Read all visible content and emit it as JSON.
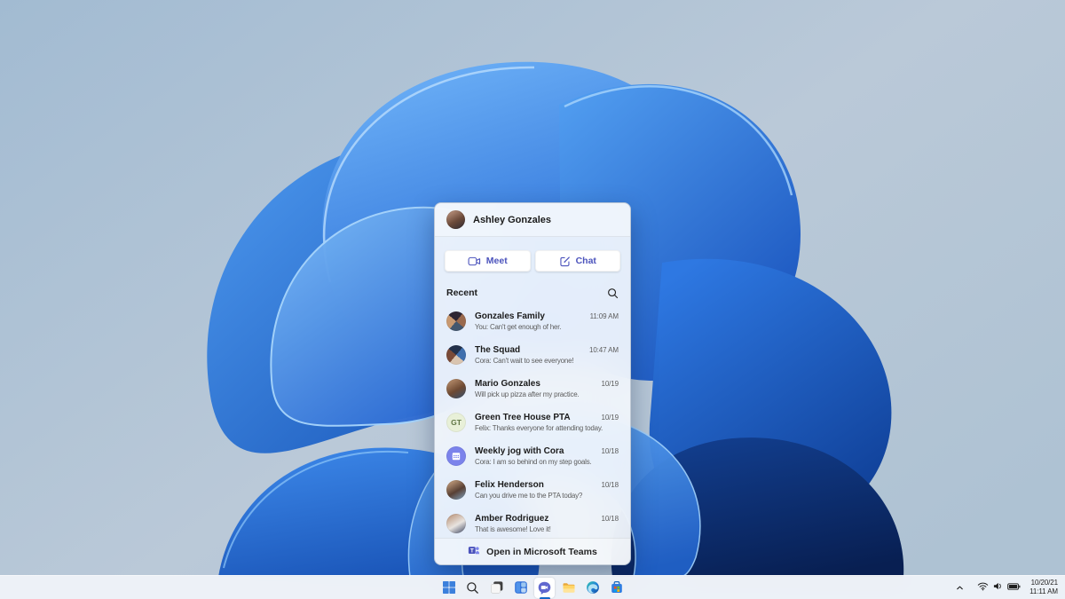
{
  "teams_panel": {
    "user": {
      "name": "Ashley Gonzales"
    },
    "actions": {
      "meet_label": "Meet",
      "chat_label": "Chat"
    },
    "recent_label": "Recent",
    "chats": [
      {
        "name": "Gonzales Family",
        "preview": "You: Can't get enough of her.",
        "time": "11:09 AM",
        "avatar": {
          "kind": "collage",
          "colors": [
            "#9a6a4e",
            "#43576e",
            "#c99a72",
            "#2e2633"
          ]
        }
      },
      {
        "name": "The Squad",
        "preview": "Cora: Can't wait to see everyone!",
        "time": "10:47 AM",
        "avatar": {
          "kind": "collage",
          "colors": [
            "#3f6fae",
            "#d9c4b0",
            "#7a4a38",
            "#23304a"
          ]
        }
      },
      {
        "name": "Mario Gonzales",
        "preview": "Will pick up pizza after my practice.",
        "time": "10/19",
        "avatar": {
          "kind": "photo",
          "colors": [
            "#c59a77",
            "#6e4a33",
            "#35506e"
          ]
        }
      },
      {
        "name": "Green Tree House PTA",
        "preview": "Felix: Thanks everyone for attending today.",
        "time": "10/19",
        "avatar": {
          "kind": "initials",
          "initials": "GT",
          "bg": "#e8f0d8",
          "fg": "#5f7544"
        }
      },
      {
        "name": "Weekly jog with Cora",
        "preview": "Cora: I am so behind on my step goals.",
        "time": "10/18",
        "avatar": {
          "kind": "glyph",
          "glyph": "calendar-icon",
          "bg": "#7b83eb"
        }
      },
      {
        "name": "Felix Henderson",
        "preview": "Can you drive me to the PTA today?",
        "time": "10/18",
        "avatar": {
          "kind": "photo",
          "colors": [
            "#d8b08c",
            "#584034",
            "#7fa3c0"
          ]
        }
      },
      {
        "name": "Amber Rodriguez",
        "preview": "That is awesome! Love it!",
        "time": "10/18",
        "avatar": {
          "kind": "photo",
          "colors": [
            "#b58a6d",
            "#e8e4e0",
            "#3c4560"
          ]
        }
      }
    ],
    "footer_label": "Open in Microsoft Teams"
  },
  "taskbar": {
    "items": [
      {
        "name": "start",
        "label": "Start",
        "active": false
      },
      {
        "name": "search",
        "label": "Search",
        "active": false
      },
      {
        "name": "task-view",
        "label": "Task View",
        "active": false
      },
      {
        "name": "widgets",
        "label": "Widgets",
        "active": false
      },
      {
        "name": "chat",
        "label": "Chat",
        "active": true
      },
      {
        "name": "file-explorer",
        "label": "File Explorer",
        "active": false
      },
      {
        "name": "edge",
        "label": "Microsoft Edge",
        "active": false
      },
      {
        "name": "store",
        "label": "Microsoft Store",
        "active": false
      }
    ],
    "tray": {
      "date": "10/20/21",
      "time": "11:11 AM"
    }
  },
  "colors": {
    "accent": "#4b53bc",
    "active_indicator": "#1668c8",
    "taskbar_bg": "#f0f3f9",
    "desktop_light": "#b7c7d7",
    "desktop_dark": "#9fb9d1",
    "bloom_bright": "#2b7de9",
    "bloom_dark": "#0a2d6e"
  }
}
